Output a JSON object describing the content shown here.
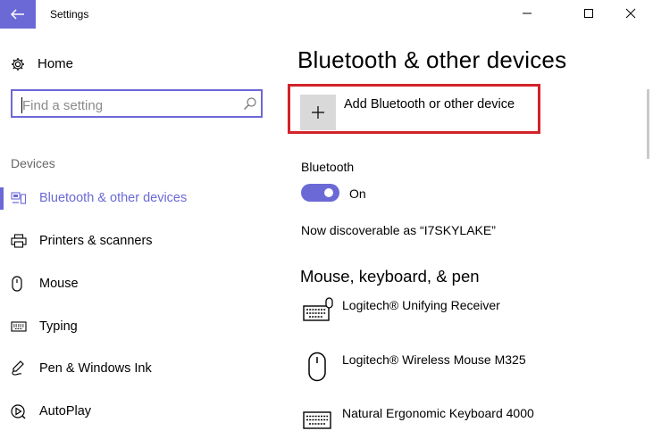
{
  "window": {
    "title": "Settings"
  },
  "sidebar": {
    "home_label": "Home",
    "search_placeholder": "Find a setting",
    "section_label": "Devices",
    "items": [
      {
        "label": "Bluetooth & other devices",
        "icon": "bluetooth-devices-icon",
        "active": true
      },
      {
        "label": "Printers & scanners",
        "icon": "printer-icon",
        "active": false
      },
      {
        "label": "Mouse",
        "icon": "mouse-icon",
        "active": false
      },
      {
        "label": "Typing",
        "icon": "keyboard-icon",
        "active": false
      },
      {
        "label": "Pen & Windows Ink",
        "icon": "pen-icon",
        "active": false
      },
      {
        "label": "AutoPlay",
        "icon": "autoplay-icon",
        "active": false
      }
    ]
  },
  "main": {
    "title": "Bluetooth & other devices",
    "add_device_label": "Add Bluetooth or other device",
    "bluetooth_label": "Bluetooth",
    "bluetooth_state": "On",
    "discoverable_text": "Now discoverable as “I7SKYLAKE”",
    "section_heading": "Mouse, keyboard, & pen",
    "devices": [
      {
        "name": "Logitech® Unifying Receiver",
        "icon": "keyboard-mouse-icon"
      },
      {
        "name": "Logitech® Wireless Mouse M325",
        "icon": "mouse-icon"
      },
      {
        "name": "Natural Ergonomic Keyboard 4000",
        "icon": "keyboard-icon"
      }
    ]
  },
  "colors": {
    "accent": "#6b69d6",
    "highlight_border": "#d2232a"
  }
}
